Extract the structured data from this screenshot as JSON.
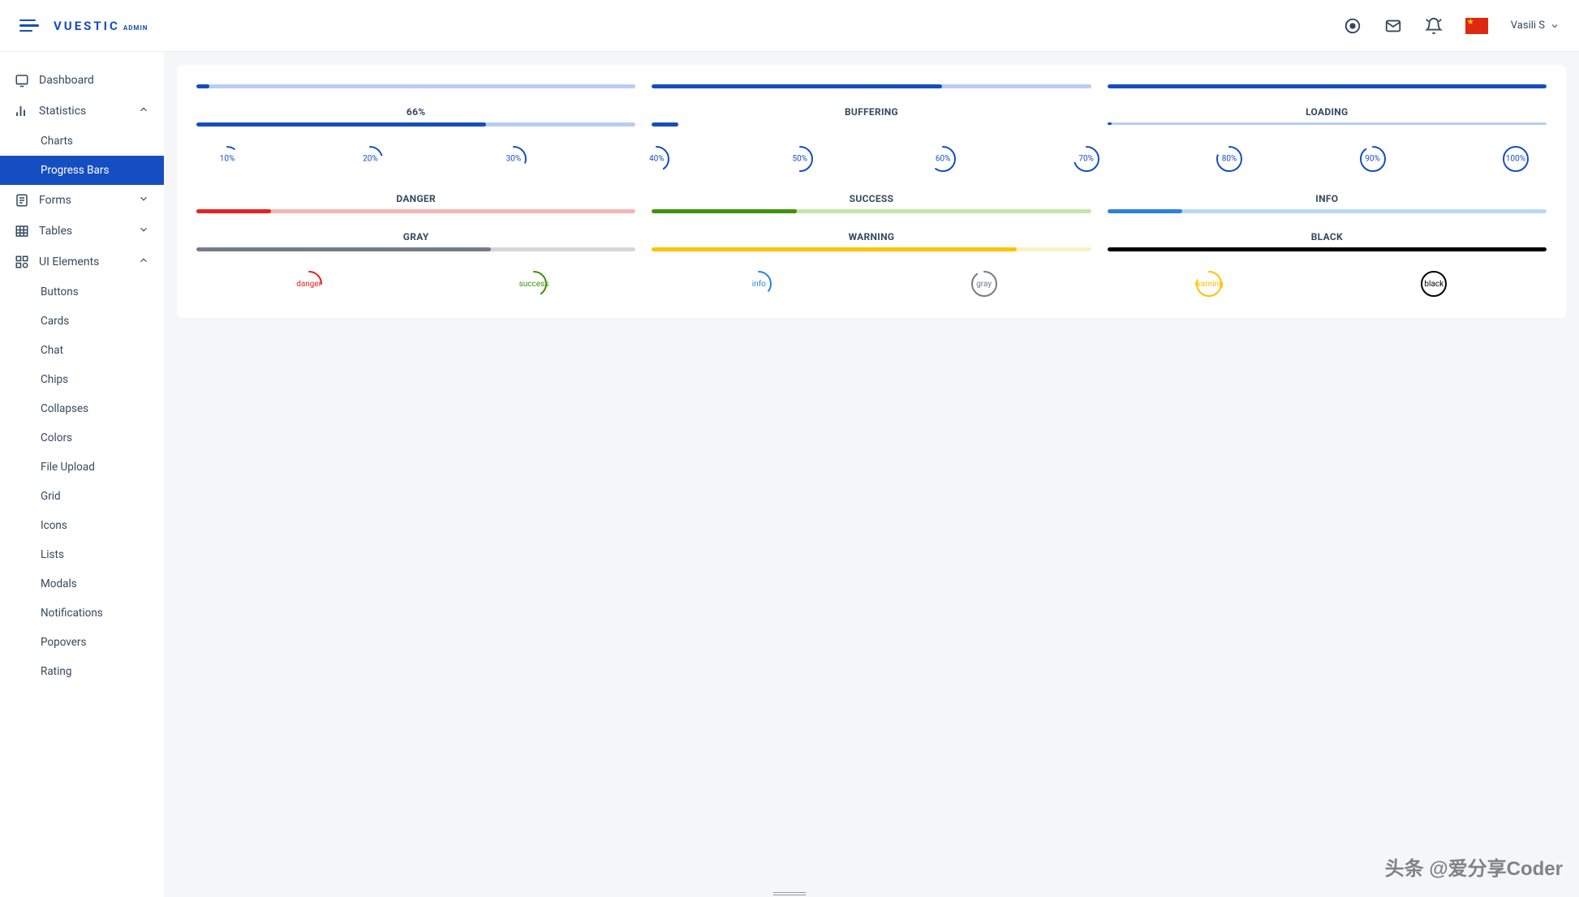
{
  "header": {
    "logo_main": "VUESTIC",
    "logo_sub": "ADMIN",
    "user_name": "Vasili S",
    "flag_locale": "zh-CN"
  },
  "sidebar": {
    "items": [
      {
        "label": "Dashboard",
        "icon": "dashboard",
        "expanded": false,
        "hasChildren": false
      },
      {
        "label": "Statistics",
        "icon": "stats",
        "expanded": true,
        "hasChildren": true,
        "children": [
          {
            "label": "Charts",
            "active": false
          },
          {
            "label": "Progress Bars",
            "active": true
          }
        ]
      },
      {
        "label": "Forms",
        "icon": "forms",
        "expanded": false,
        "hasChildren": true
      },
      {
        "label": "Tables",
        "icon": "tables",
        "expanded": false,
        "hasChildren": true
      },
      {
        "label": "UI Elements",
        "icon": "ui",
        "expanded": true,
        "hasChildren": true,
        "children": [
          {
            "label": "Buttons"
          },
          {
            "label": "Cards"
          },
          {
            "label": "Chat"
          },
          {
            "label": "Chips"
          },
          {
            "label": "Collapses"
          },
          {
            "label": "Colors"
          },
          {
            "label": "File Upload"
          },
          {
            "label": "Grid"
          },
          {
            "label": "Icons"
          },
          {
            "label": "Lists"
          },
          {
            "label": "Modals"
          },
          {
            "label": "Notifications"
          },
          {
            "label": "Popovers"
          },
          {
            "label": "Rating"
          }
        ]
      }
    ]
  },
  "progress": {
    "row1": [
      {
        "value": 3,
        "track": "#b8cdf1",
        "fill": "#154ec1"
      },
      {
        "value": 66,
        "track": "#b8cdf1",
        "fill": "#154ec1"
      },
      {
        "value": 100,
        "track": "#b8cdf1",
        "fill": "#154ec1"
      }
    ],
    "row2": [
      {
        "label": "66%",
        "value": 66,
        "track": "#b8cdf1",
        "fill": "#154ec1"
      },
      {
        "label": "BUFFERING",
        "value": 6,
        "track": "transparent",
        "fill": "#154ec1"
      },
      {
        "label": "LOADING",
        "value": 1,
        "track": "#b8cdf1",
        "fill": "#154ec1",
        "thin": true
      }
    ],
    "circles": [
      {
        "pct": 10,
        "label": "10%"
      },
      {
        "pct": 20,
        "label": "20%"
      },
      {
        "pct": 30,
        "label": "30%"
      },
      {
        "pct": 40,
        "label": "40%"
      },
      {
        "pct": 50,
        "label": "50%"
      },
      {
        "pct": 60,
        "label": "60%"
      },
      {
        "pct": 70,
        "label": "70%"
      },
      {
        "pct": 80,
        "label": "80%"
      },
      {
        "pct": 90,
        "label": "90%"
      },
      {
        "pct": 100,
        "label": "100%"
      }
    ],
    "colorBars1": [
      {
        "label": "DANGER",
        "value": 17,
        "track": "#f5b5b5",
        "fill": "#e42222"
      },
      {
        "label": "SUCCESS",
        "value": 33,
        "track": "#c6e3b0",
        "fill": "#3d9209"
      },
      {
        "label": "INFO",
        "value": 17,
        "track": "#b8d9f5",
        "fill": "#2c82e0"
      }
    ],
    "colorBars2": [
      {
        "label": "GRAY",
        "value": 67,
        "track": "#d6d6d6",
        "fill": "#767c88"
      },
      {
        "label": "WARNING",
        "value": 83,
        "track": "#fef1c0",
        "fill": "#ffc200"
      },
      {
        "label": "BLACK",
        "value": 100,
        "track": "#999",
        "fill": "#000000"
      }
    ],
    "colorCircles": [
      {
        "label": "danger",
        "color": "#e42222",
        "pct": 25
      },
      {
        "label": "success",
        "color": "#3d9209",
        "pct": 40
      },
      {
        "label": "info",
        "color": "#2c82e0",
        "pct": 35
      },
      {
        "label": "gray",
        "color": "#767c88",
        "pct": 90
      },
      {
        "label": "warning",
        "color": "#ffc200",
        "pct": 80
      },
      {
        "label": "black",
        "color": "#000000",
        "pct": 100
      }
    ]
  },
  "watermark": "头条 @爱分享Coder",
  "colors": {
    "primary": "#154ec1",
    "danger": "#e42222",
    "success": "#3d9209",
    "info": "#2c82e0",
    "gray": "#767c88",
    "warning": "#ffc200",
    "black": "#000000"
  }
}
